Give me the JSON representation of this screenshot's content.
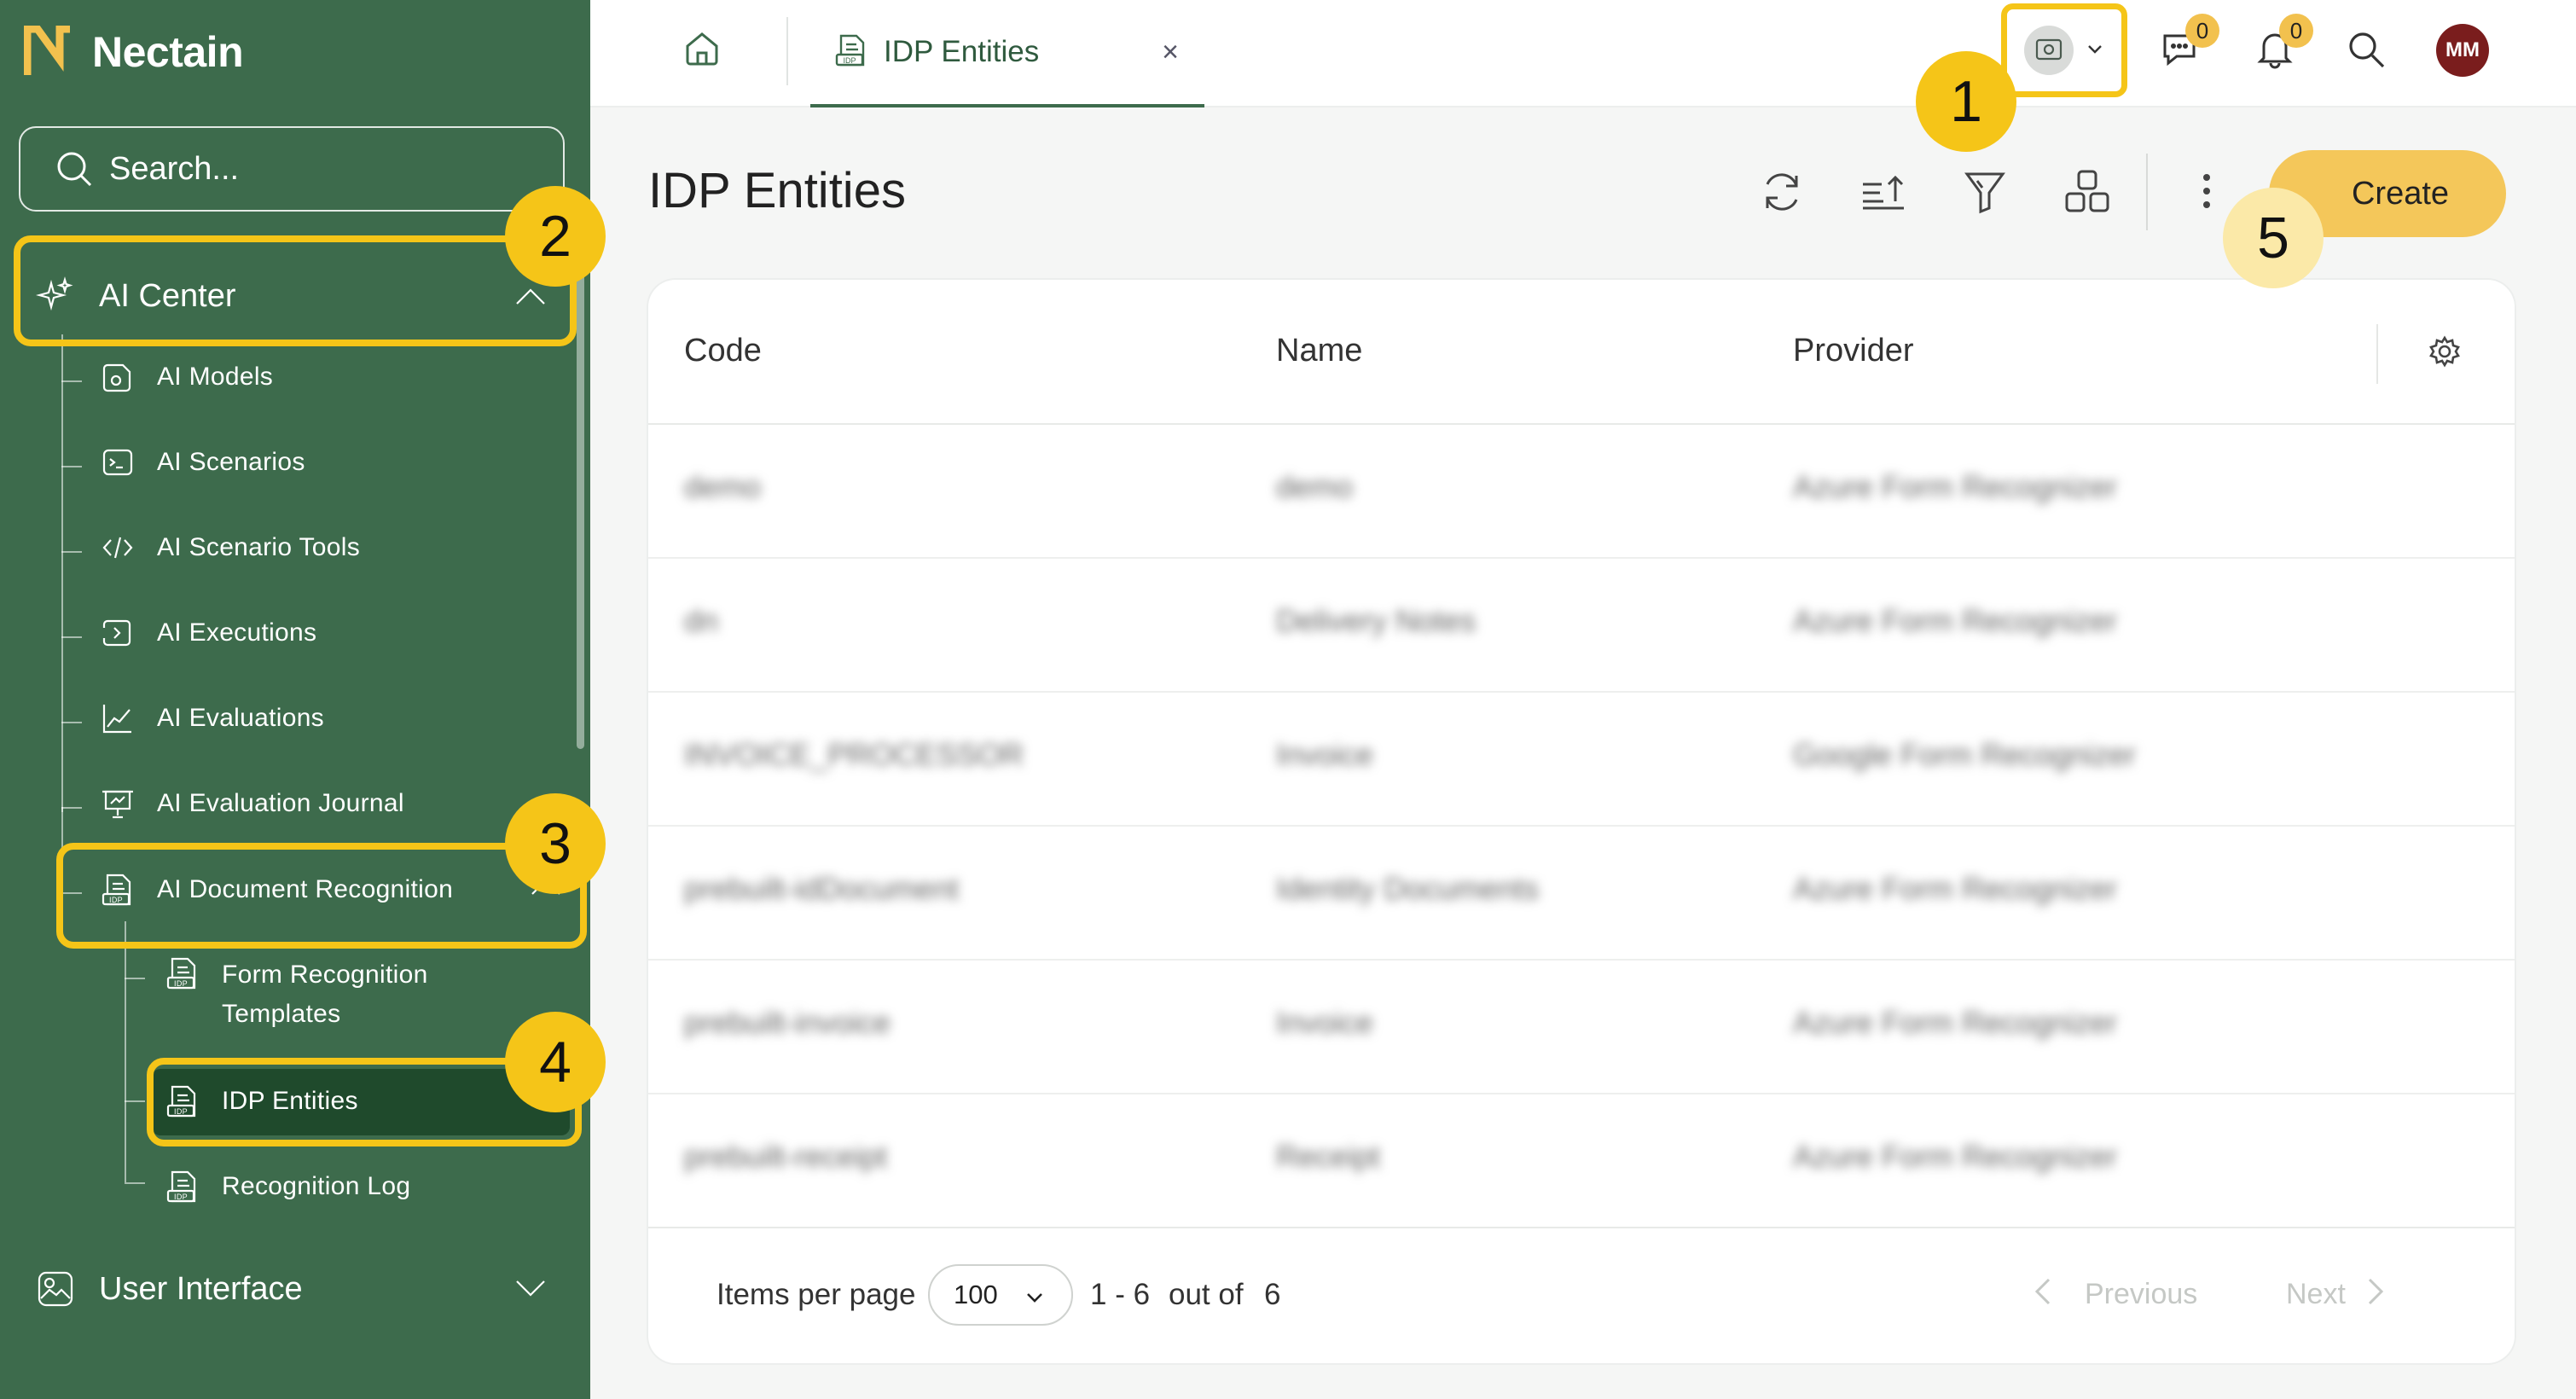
{
  "app": {
    "name": "Nectain",
    "brand_color": "#3d6b4c",
    "accent_color": "#f5c518"
  },
  "sidebar": {
    "search_placeholder": "Search...",
    "sections": [
      {
        "label": "AI Center",
        "icon": "sparkles-icon",
        "expanded": true,
        "items": [
          {
            "label": "AI Models",
            "icon": "ai-model-icon"
          },
          {
            "label": "AI Scenarios",
            "icon": "terminal-icon"
          },
          {
            "label": "AI Scenario Tools",
            "icon": "code-icon"
          },
          {
            "label": "AI Executions",
            "icon": "play-icon"
          },
          {
            "label": "AI Evaluations",
            "icon": "line-chart-icon"
          },
          {
            "label": "AI Evaluation Journal",
            "icon": "presentation-icon"
          },
          {
            "label": "AI Document Recognition",
            "icon": "idp-document-icon",
            "expanded": true,
            "children": [
              {
                "label_line1": "Form Recognition",
                "label_line2": "Templates",
                "icon": "idp-document-icon"
              },
              {
                "label": "IDP Entities",
                "icon": "idp-document-icon",
                "active": true
              },
              {
                "label": "Recognition Log",
                "icon": "idp-document-icon"
              }
            ]
          }
        ]
      },
      {
        "label": "User Interface",
        "icon": "image-icon",
        "expanded": false
      }
    ]
  },
  "topbar": {
    "tab_label": "IDP Entities",
    "tab_close": "×",
    "chat_count": "0",
    "notification_count": "0",
    "avatar_initials": "MM"
  },
  "page": {
    "title": "IDP Entities",
    "create_label": "Create"
  },
  "table": {
    "columns": [
      "Code",
      "Name",
      "Provider"
    ],
    "rows": [
      [
        "demo",
        "demo",
        "Azure Form Recognizer"
      ],
      [
        "dn",
        "Delivery Notes",
        "Azure Form Recognizer"
      ],
      [
        "INVOICE_PROCESSOR",
        "Invoice",
        "Google Form Recognizer"
      ],
      [
        "prebuilt-idDocument",
        "Identity Documents",
        "Azure Form Recognizer"
      ],
      [
        "prebuilt-invoice",
        "Invoice",
        "Azure Form Recognizer"
      ],
      [
        "prebuilt-receipt",
        "Receipt",
        "Azure Form Recognizer"
      ]
    ]
  },
  "pagination": {
    "items_per_page_label": "Items per page",
    "items_per_page_value": "100",
    "range": "1 - 6",
    "out_of_label": "out of",
    "total": "6",
    "previous_label": "Previous",
    "next_label": "Next"
  },
  "callouts": [
    "1",
    "2",
    "3",
    "4",
    "5"
  ]
}
